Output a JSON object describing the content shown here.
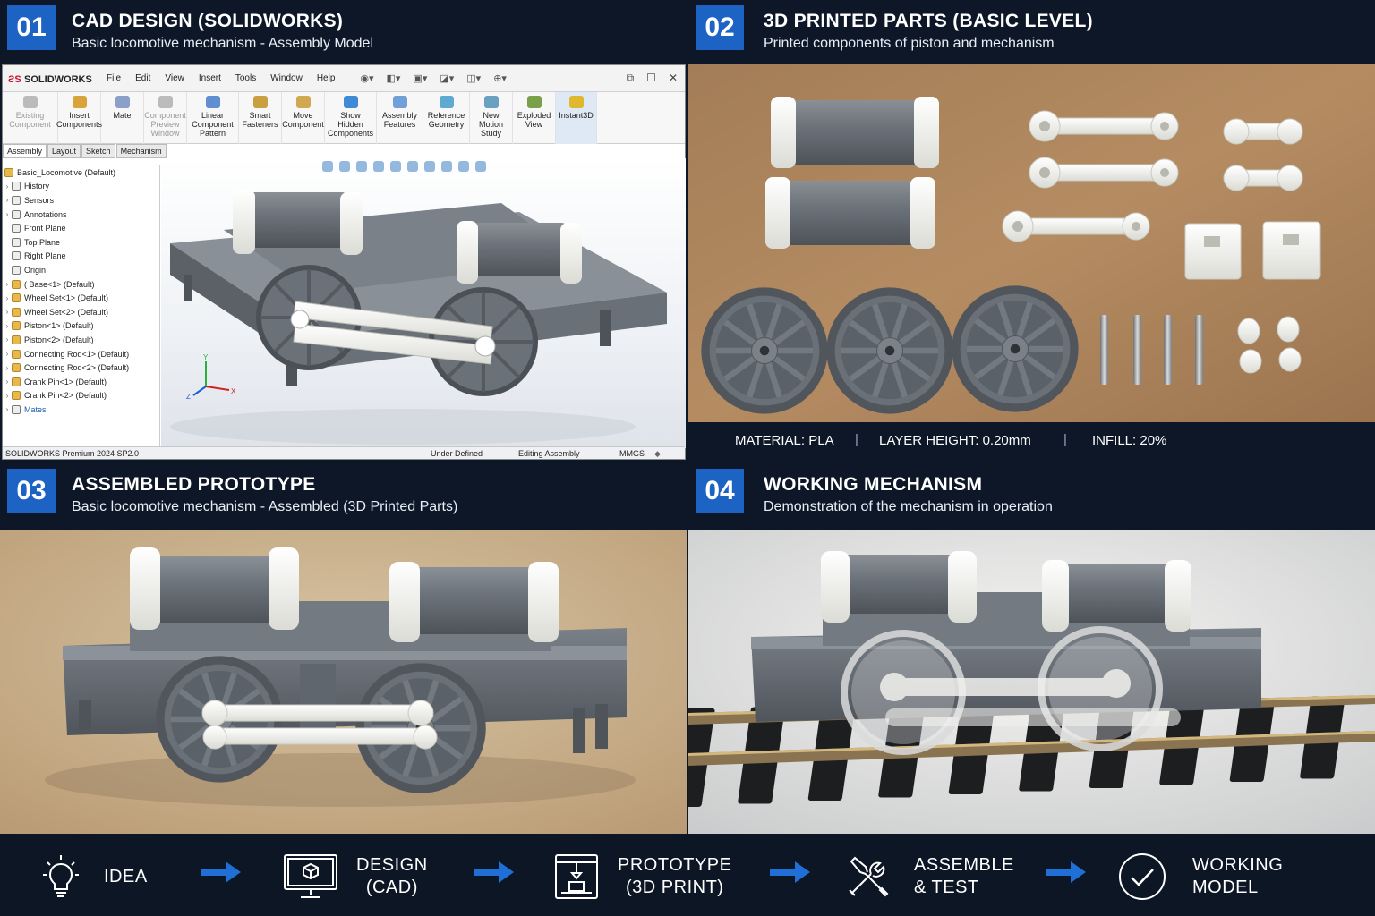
{
  "panels": [
    {
      "num": "01",
      "title": "CAD DESIGN (SOLIDWORKS)",
      "subtitle": "Basic locomotive mechanism - Assembly Model"
    },
    {
      "num": "02",
      "title": "3D PRINTED PARTS (BASIC LEVEL)",
      "subtitle": "Printed components of piston and mechanism"
    },
    {
      "num": "03",
      "title": "ASSEMBLED PROTOTYPE",
      "subtitle": "Basic locomotive mechanism - Assembled (3D Printed Parts)"
    },
    {
      "num": "04",
      "title": "WORKING MECHANISM",
      "subtitle": "Demonstration of the mechanism in operation"
    }
  ],
  "solidworks": {
    "logo": "SOLIDWORKS",
    "menu": [
      "File",
      "Edit",
      "View",
      "Insert",
      "Tools",
      "Window",
      "Help"
    ],
    "ribbon": [
      {
        "label": "Existing Component",
        "dim": true
      },
      {
        "label": "Insert Components"
      },
      {
        "label": "Mate"
      },
      {
        "label": "Component Preview Window",
        "dim": true
      },
      {
        "label": "Linear Component Pattern"
      },
      {
        "label": "Smart Fasteners"
      },
      {
        "label": "Move Component"
      },
      {
        "label": "Show Hidden Components"
      },
      {
        "label": "Assembly Features"
      },
      {
        "label": "Reference Geometry"
      },
      {
        "label": "New Motion Study"
      },
      {
        "label": "Exploded View"
      },
      {
        "label": "Instant3D",
        "active": true
      }
    ],
    "tabs": [
      "Assembly",
      "Layout",
      "Sketch",
      "Mechanism"
    ],
    "tree": [
      {
        "label": "Basic_Locomotive  (Default)",
        "kind": "root"
      },
      {
        "label": "History",
        "kind": "folder"
      },
      {
        "label": "Sensors",
        "kind": "folder"
      },
      {
        "label": "Annotations",
        "kind": "folder"
      },
      {
        "label": "Front Plane",
        "kind": "plane"
      },
      {
        "label": "Top Plane",
        "kind": "plane"
      },
      {
        "label": "Right Plane",
        "kind": "plane"
      },
      {
        "label": "Origin",
        "kind": "origin"
      },
      {
        "label": "( Base<1>  (Default)",
        "kind": "part"
      },
      {
        "label": "Wheel Set<1>  (Default)",
        "kind": "part"
      },
      {
        "label": "Wheel Set<2>  (Default)",
        "kind": "part"
      },
      {
        "label": "Piston<1>  (Default)",
        "kind": "part"
      },
      {
        "label": "Piston<2>  (Default)",
        "kind": "part"
      },
      {
        "label": "Connecting Rod<1>  (Default)",
        "kind": "part"
      },
      {
        "label": "Connecting Rod<2>  (Default)",
        "kind": "part"
      },
      {
        "label": "Crank Pin<1>  (Default)",
        "kind": "part"
      },
      {
        "label": "Crank Pin<2>  (Default)",
        "kind": "part"
      },
      {
        "label": "Mates",
        "kind": "mates"
      }
    ],
    "axes": {
      "x": "X",
      "y": "Y",
      "z": "Z"
    },
    "status": {
      "version": "SOLIDWORKS Premium 2024 SP2.0",
      "state": "Under Defined",
      "mode": "Editing Assembly",
      "units": "MMGS"
    }
  },
  "specs": {
    "material": "MATERIAL: PLA",
    "layer": "LAYER HEIGHT: 0.20mm",
    "infill": "INFILL: 20%",
    "separator": "|"
  },
  "flow": [
    {
      "line1": "IDEA",
      "line2": "",
      "icon": "lightbulb-icon"
    },
    {
      "line1": "DESIGN",
      "line2": "(CAD)",
      "icon": "monitor-cube-icon"
    },
    {
      "line1": "PROTOTYPE",
      "line2": "(3D PRINT)",
      "icon": "3d-printer-icon"
    },
    {
      "line1": "ASSEMBLE",
      "line2": "& TEST",
      "icon": "tools-icon"
    },
    {
      "line1": "WORKING",
      "line2": "MODEL",
      "icon": "check-circle-icon"
    }
  ],
  "colors": {
    "accent": "#1c63c4",
    "arrow": "#1f6fd6",
    "header_bg": "#0d1728",
    "part_grey": "#6f757c",
    "part_white": "#f2f2ef"
  }
}
